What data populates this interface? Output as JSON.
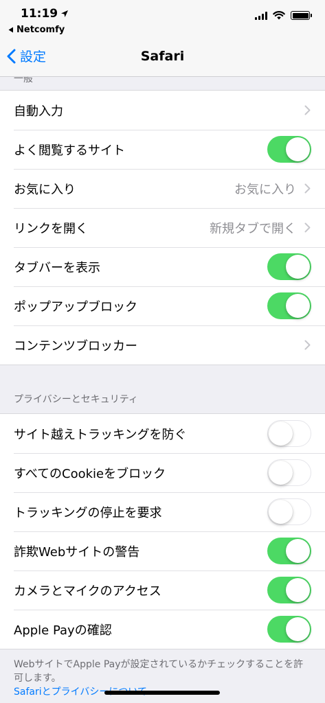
{
  "status": {
    "time": "11:19",
    "back_app": "Netcomfy"
  },
  "nav": {
    "back_label": "設定",
    "title": "Safari"
  },
  "general": {
    "header": "一般",
    "rows": [
      {
        "label": "自動入力",
        "type": "chevron"
      },
      {
        "label": "よく閲覧するサイト",
        "type": "toggle",
        "on": true
      },
      {
        "label": "お気に入り",
        "type": "value",
        "value": "お気に入り"
      },
      {
        "label": "リンクを開く",
        "type": "value",
        "value": "新規タブで開く"
      },
      {
        "label": "タブバーを表示",
        "type": "toggle",
        "on": true
      },
      {
        "label": "ポップアップブロック",
        "type": "toggle",
        "on": true
      },
      {
        "label": "コンテンツブロッカー",
        "type": "chevron"
      }
    ]
  },
  "privacy": {
    "header": "プライバシーとセキュリティ",
    "rows": [
      {
        "label": "サイト越えトラッキングを防ぐ",
        "type": "toggle",
        "on": false
      },
      {
        "label": "すべてのCookieをブロック",
        "type": "toggle",
        "on": false
      },
      {
        "label": "トラッキングの停止を要求",
        "type": "toggle",
        "on": false
      },
      {
        "label": "詐欺Webサイトの警告",
        "type": "toggle",
        "on": true
      },
      {
        "label": "カメラとマイクのアクセス",
        "type": "toggle",
        "on": true
      },
      {
        "label": "Apple Payの確認",
        "type": "toggle",
        "on": true
      }
    ],
    "footer_text": "WebサイトでApple Payが設定されているかチェックすることを許可します。",
    "footer_link": "Safariとプライバシーについて..."
  },
  "colors": {
    "accent": "#007aff",
    "toggle_on": "#4cd964",
    "background": "#efeff4"
  }
}
